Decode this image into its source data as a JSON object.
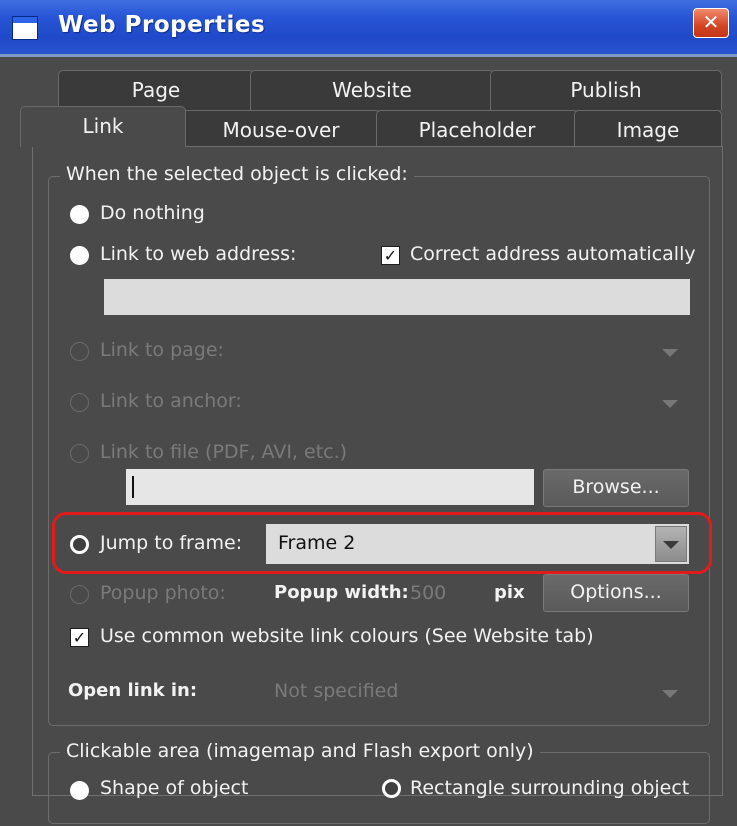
{
  "window": {
    "title": "Web Properties",
    "close_label": "✕"
  },
  "tabs": {
    "row1": [
      "Page",
      "Website",
      "Publish"
    ],
    "row2": [
      "Link",
      "Mouse-over",
      "Placeholder",
      "Image"
    ],
    "active": "Link"
  },
  "click_group": {
    "legend": "When the selected object is clicked:",
    "do_nothing": {
      "label": "Do nothing",
      "selected": false
    },
    "web_address": {
      "label": "Link to web address:",
      "selected": false,
      "value": ""
    },
    "correct_address": {
      "label": "Correct address automatically",
      "checked": true
    },
    "link_page": {
      "label": "Link to page:",
      "enabled": false
    },
    "link_anchor": {
      "label": "Link to anchor:",
      "enabled": false
    },
    "link_file": {
      "label": "Link to file (PDF, AVI, etc.)",
      "enabled": false,
      "value": ""
    },
    "browse_button": "Browse...",
    "jump_frame": {
      "label": "Jump to frame:",
      "selected": true,
      "value": "Frame 2"
    },
    "popup_photo": {
      "label": "Popup photo:",
      "enabled": false
    },
    "popup_width_label": "Popup width:",
    "popup_width_value": "500",
    "popup_unit": "pix",
    "options_button": "Options...",
    "common_colours": {
      "label": "Use common website link colours (See Website tab)",
      "checked": true
    },
    "open_link_label": "Open link in:",
    "open_link_value": "Not specified"
  },
  "area_group": {
    "legend": "Clickable area (imagemap and Flash export only)",
    "shape_option": {
      "label": "Shape of object",
      "selected": false
    },
    "rect_option": {
      "label": "Rectangle surrounding object",
      "selected": true
    }
  },
  "colors": {
    "dialog_bg": "#4a4a4a",
    "title_bar": "#2856d6",
    "highlight_border": "#e01b1b"
  }
}
